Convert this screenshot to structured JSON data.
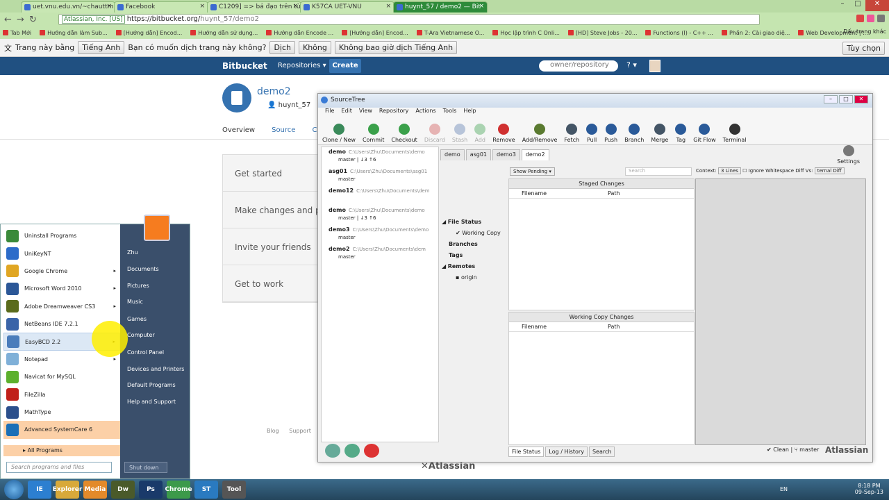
{
  "browser": {
    "tabs": [
      {
        "label": "uet.vnu.edu.vn/~chauttm"
      },
      {
        "label": "Facebook"
      },
      {
        "label": "C1209] => bả đạo trên từ"
      },
      {
        "label": "K57CA UET-VNU"
      },
      {
        "label": "huynt_57 / demo2 — Bit"
      }
    ],
    "url_secure": "Atlassian, Inc. [US]",
    "url_base": "https://bitbucket.org/",
    "url_path": "huynt_57/demo2",
    "bookmarks": [
      "Tab Mới",
      "Hướng dẫn làm Sub...",
      "[Hướng dẫn] Encod...",
      "Hướng dẫn sử dụng...",
      "Hướng dẫn Encode ...",
      "[Hướng dẫn] Encod...",
      "T-Ara Vietnamese O...",
      "Học lập trình C Onli...",
      "[HD] Steve Jobs - 20...",
      "Functions (I) - C++ ...",
      "Phần 2: Cài giao diệ...",
      "Web Development | ..."
    ],
    "bookmarks_other": "Dấu trang khác"
  },
  "translate": {
    "prefix": "Trang này bằng",
    "language": "Tiếng Anh",
    "question": "Bạn có muốn dịch trang này không?",
    "translate_btn": "Dịch",
    "no_btn": "Không",
    "never_btn": "Không bao giờ dịch Tiếng Anh",
    "options": "Tùy chọn"
  },
  "bitbucket": {
    "logo": "Bitbucket",
    "repositories": "Repositories ▾",
    "create": "Create",
    "search_placeholder": "owner/repository",
    "help": "? ▾",
    "repo_name": "demo2",
    "owner": "huynt_57",
    "tabs": {
      "overview": "Overview",
      "source": "Source",
      "more": "Co"
    },
    "getting_started": [
      "Get started",
      "Make changes and pu",
      "Invite your friends",
      "Get to work"
    ],
    "footer": [
      "Blog",
      "Support"
    ],
    "footer_brand": "Atlassian"
  },
  "startmenu": {
    "programs": [
      {
        "label": "Uninstall Programs",
        "color": "#3a8a3a"
      },
      {
        "label": "UniKeyNT",
        "color": "#2c6cc9"
      },
      {
        "label": "Google Chrome",
        "color": "#e0a623",
        "arrow": true
      },
      {
        "label": "Microsoft Word 2010",
        "color": "#2b5797",
        "arrow": true
      },
      {
        "label": "Adobe Dreamweaver CS3",
        "color": "#5a6b1b",
        "arrow": true
      },
      {
        "label": "NetBeans IDE 7.2.1",
        "color": "#3a64a8"
      },
      {
        "label": "EasyBCD 2.2",
        "color": "#4b7dbb",
        "arrow": true,
        "highlight": true
      },
      {
        "label": "Notepad",
        "color": "#7fb0d8",
        "arrow": true
      },
      {
        "label": "Navicat for MySQL",
        "color": "#5cb02d"
      },
      {
        "label": "FileZilla",
        "color": "#c0201a"
      },
      {
        "label": "MathType",
        "color": "#2b4f8c"
      },
      {
        "label": "Advanced SystemCare 6",
        "color": "#1a6fb7",
        "adv": true
      }
    ],
    "all_programs": "All Programs",
    "search_placeholder": "Search programs and files",
    "right_items": [
      "Zhu",
      "Documents",
      "Pictures",
      "Music",
      "Games",
      "Computer",
      "Control Panel",
      "Devices and Printers",
      "Default Programs",
      "Help and Support"
    ],
    "shutdown": "Shut down"
  },
  "sourcetree": {
    "title": "SourceTree",
    "menu": [
      "File",
      "Edit",
      "View",
      "Repository",
      "Actions",
      "Tools",
      "Help"
    ],
    "toolbar": [
      {
        "label": "Clone / New",
        "color": "#3a8a5a"
      },
      {
        "label": "Commit",
        "color": "#3aa04a"
      },
      {
        "label": "Checkout",
        "color": "#3aa04a"
      },
      {
        "label": "Discard",
        "color": "#d05050",
        "disabled": true
      },
      {
        "label": "Stash",
        "color": "#5a7ab0",
        "disabled": true
      },
      {
        "label": "Add",
        "color": "#3aa04a",
        "disabled": true
      },
      {
        "label": "Remove",
        "color": "#d03030"
      },
      {
        "label": "Add/Remove",
        "color": "#5a7a30"
      },
      {
        "label": "Fetch",
        "color": "#445566"
      },
      {
        "label": "Pull",
        "color": "#2a5a99"
      },
      {
        "label": "Push",
        "color": "#2a5a99"
      },
      {
        "label": "Branch",
        "color": "#2a5a99"
      },
      {
        "label": "Merge",
        "color": "#445566"
      },
      {
        "label": "Tag",
        "color": "#2a5a99"
      },
      {
        "label": "Git Flow",
        "color": "#2a5a99"
      },
      {
        "label": "Terminal",
        "color": "#333333"
      }
    ],
    "settings": "Settings",
    "repos": [
      {
        "name": "demo",
        "path": "C:\\Users\\Zhu\\Documents\\demo",
        "branch": "master",
        "behind": "3",
        "ahead": "6"
      },
      {
        "name": "asg01",
        "path": "C:\\Users\\Zhu\\Documents\\asg01",
        "branch": "master"
      },
      {
        "name": "demo12",
        "path": "C:\\Users\\Zhu\\Documents\\dem",
        "branch": ""
      },
      {
        "name": "demo",
        "path": "C:\\Users\\Zhu\\Documents\\demo",
        "branch": "master",
        "behind": "3",
        "ahead": "6"
      },
      {
        "name": "demo3",
        "path": "C:\\Users\\Zhu\\Documents\\demo",
        "branch": "master"
      },
      {
        "name": "demo2",
        "path": "C:\\Users\\Zhu\\Documents\\dem",
        "branch": "master"
      }
    ],
    "open_tabs": [
      "demo",
      "asg01",
      "demo3",
      "demo2"
    ],
    "file_status": "File Status",
    "working_copy": "Working Copy",
    "branches": "Branches",
    "tags": "Tags",
    "remotes": "Remotes",
    "origin": "origin",
    "show_pending": "Show Pending",
    "search": "Search",
    "context_label": "Context:",
    "context_value": "3 Lines",
    "ignore_whitespace": "Ignore Whitespace",
    "diff_vs": "Diff Vs:",
    "external_diff": "ternal Diff",
    "staged_changes": "Staged Changes",
    "working_copy_changes": "Working Copy Changes",
    "col_filename": "Filename",
    "col_path": "Path",
    "bottom_tabs": [
      "File Status",
      "Log / History",
      "Search"
    ],
    "status_clean": "Clean",
    "status_branch": "master",
    "brand": "Atlassian"
  },
  "taskbar": {
    "icons": [
      "IE",
      "Explorer",
      "Media",
      "Dw",
      "Ps",
      "Chrome",
      "ST",
      "Tool"
    ],
    "language": "EN",
    "time": "8:18 PM",
    "date": "09-Sep-13"
  }
}
